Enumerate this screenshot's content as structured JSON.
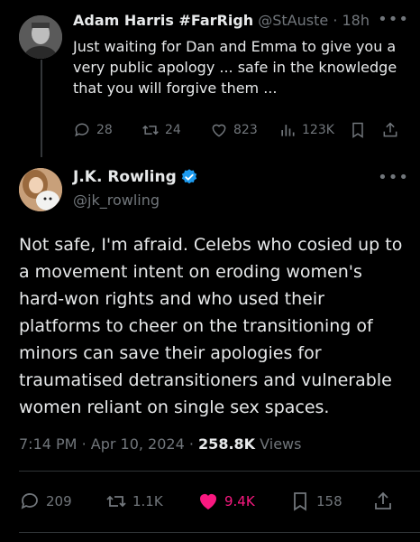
{
  "reply": {
    "name": "Adam Harris #FarRigh",
    "handle": "@StAuste",
    "separator": "·",
    "time": "18h",
    "more": "•••",
    "text": "Just waiting for Dan and Emma to give you a very public apology ... safe in the knowledge that you will forgive them ...",
    "replies": "28",
    "reposts": "24",
    "likes": "823",
    "views": "123K",
    "icons": [
      "reply-icon",
      "repost-icon",
      "like-icon",
      "views-icon",
      "bookmark-icon",
      "share-icon"
    ]
  },
  "main": {
    "name": "J.K. Rowling",
    "verified_color": "#1d9bf0",
    "handle": "@jk_rowling",
    "more": "•••",
    "text": "Not safe, I'm afraid. Celebs who cosied up to a movement intent on eroding women's hard-won rights and who used their platforms to cheer on the transitioning of minors can save their apologies for traumatised detransitioners and vulnerable women reliant on single sex spaces.",
    "time": "7:14 PM",
    "separator": "·",
    "date": "Apr 10, 2024",
    "separator2": "·",
    "views_count": "258.8K",
    "views_label": "Views",
    "replies": "209",
    "reposts": "1.1K",
    "likes": "9.4K",
    "bookmarks": "158",
    "liked_color": "#f91880"
  }
}
